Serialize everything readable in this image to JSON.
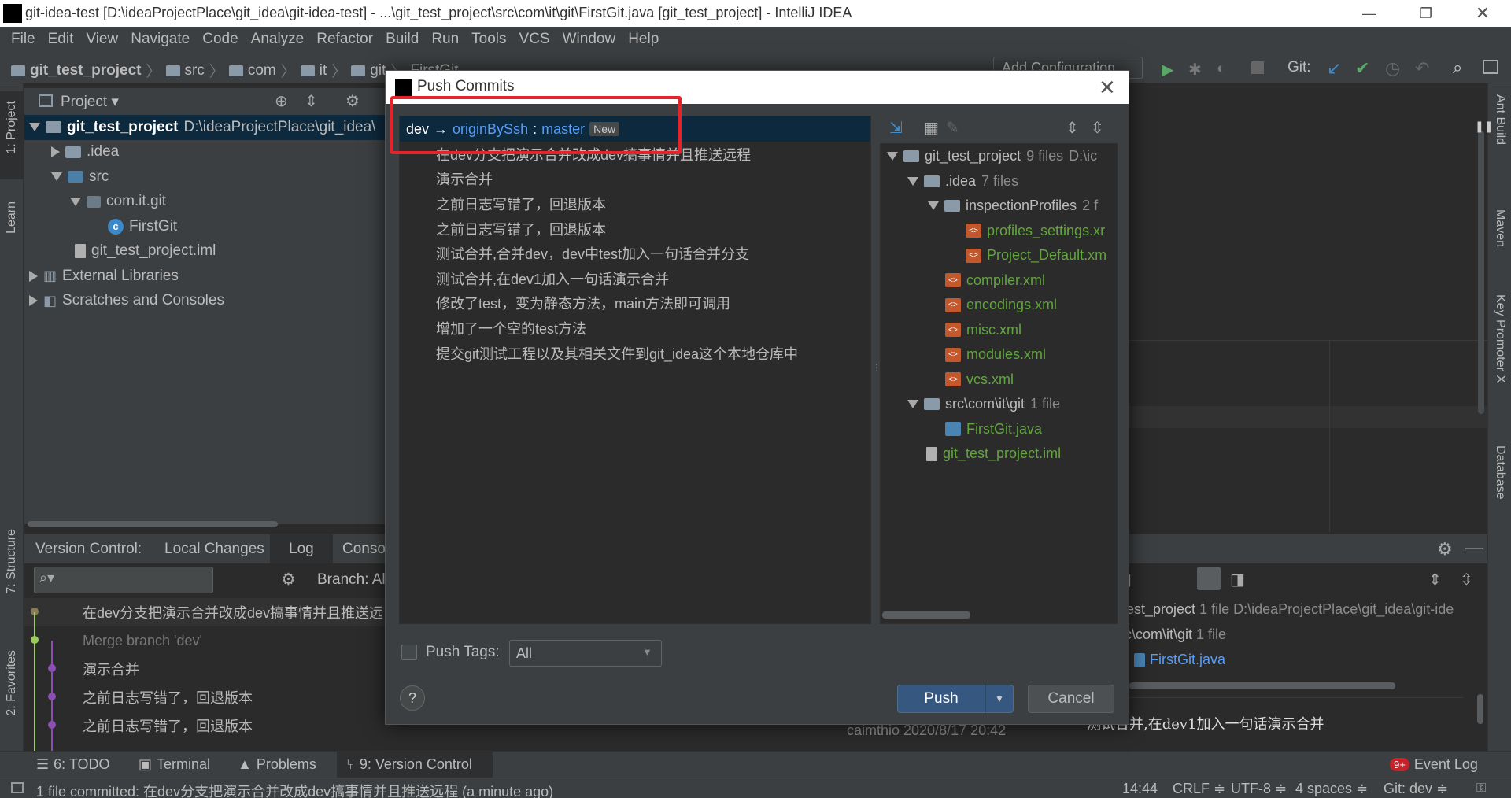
{
  "window": {
    "title": "git-idea-test [D:\\ideaProjectPlace\\git_idea\\git-idea-test] - ...\\git_test_project\\src\\com\\it\\git\\FirstGit.java [git_test_project] - IntelliJ IDEA"
  },
  "menu": [
    "File",
    "Edit",
    "View",
    "Navigate",
    "Code",
    "Analyze",
    "Refactor",
    "Build",
    "Run",
    "Tools",
    "VCS",
    "Window",
    "Help"
  ],
  "breadcrumb": [
    "git_test_project",
    "src",
    "com",
    "it",
    "git",
    "FirstGit"
  ],
  "navbar": {
    "run_config": "Add Configuration...",
    "git_label": "Git:"
  },
  "left_strip": {
    "project": "1: Project",
    "learn": "Learn",
    "structure": "7: Structure",
    "favorites": "2: Favorites"
  },
  "right_strip": {
    "ant": "Ant Build",
    "maven": "Maven",
    "key_promoter": "Key Promoter X",
    "database": "Database"
  },
  "project_panel": {
    "title": "Project",
    "root_name": "git_test_project",
    "root_path": "D:\\ideaProjectPlace\\git_idea\\",
    "items": [
      ".idea",
      "src",
      "com.it.git",
      "FirstGit",
      "git_test_project.iml",
      "External Libraries",
      "Scratches and Consoles"
    ]
  },
  "vc_panel": {
    "label": "Version Control:",
    "tabs": [
      "Local Changes",
      "Log",
      "Conso"
    ],
    "branch": "Branch: Al",
    "search_placeholder": "",
    "log": [
      "在dev分支把演示合并改成dev搞事情并且推送远",
      "Merge branch 'dev'",
      "演示合并",
      "之前日志写错了，回退版本",
      "之前日志写错了，回退版本"
    ],
    "right_tree": {
      "root": "est_project",
      "root_count": "1 file",
      "root_path": "D:\\ideaProjectPlace\\git_idea\\git-ide",
      "pkg": "c\\com\\it\\git",
      "pkg_count": "1 file",
      "file": "FirstGit.java"
    },
    "detail_text": "测试合并,在dev1加入一句话演示合并",
    "author_line": "caimthio   2020/8/17 20:42"
  },
  "dialog": {
    "title": "Push Commits",
    "push_target": {
      "source": "dev",
      "arrow": "→",
      "remote": "originBySsh",
      "sep": ":",
      "branch": "master",
      "badge": "New"
    },
    "commits": [
      "在dev分支把演示合并改成dev搞事情并且推送远程",
      "演示合并",
      "之前日志写错了，回退版本",
      "之前日志写错了，回退版本",
      "测试合并,合并dev，dev中test加入一句话合并分支",
      "测试合并,在dev1加入一句话演示合并",
      "修改了test，变为静态方法，main方法即可调用",
      "增加了一个空的test方法",
      "提交git测试工程以及其相关文件到git_idea这个本地仓库中"
    ],
    "files": {
      "root": "git_test_project",
      "root_count": "9 files",
      "root_path": "D:\\ic",
      "idea": ".idea",
      "idea_count": "7 files",
      "inspection": "inspectionProfiles",
      "inspection_count": "2 f",
      "profiles": "profiles_settings.xr",
      "project_default": "Project_Default.xm",
      "compiler": "compiler.xml",
      "encodings": "encodings.xml",
      "misc": "misc.xml",
      "modules": "modules.xml",
      "vcs": "vcs.xml",
      "src": "src\\com\\it\\git",
      "src_count": "1 file",
      "firstgit": "FirstGit.java",
      "iml": "git_test_project.iml"
    },
    "push_tags_label": "Push Tags:",
    "push_tags_value": "All",
    "push_label": "Push",
    "cancel_label": "Cancel",
    "help": "?"
  },
  "bottom_tools": {
    "todo": "6: TODO",
    "terminal": "Terminal",
    "problems": "Problems",
    "vc": "9: Version Control",
    "event_badge": "9+",
    "event": "Event Log"
  },
  "status": {
    "message": "1 file committed: 在dev分支把演示合并改成dev搞事情并且推送远程 (a minute ago)",
    "pos": "14:44",
    "crlf": "CRLF ≑",
    "encoding": "UTF-8 ≑",
    "indent": "4 spaces ≑",
    "git": "Git: dev ≑"
  },
  "colors": {
    "accent": "#589df6",
    "highlight": "#e8222b",
    "bg": "#3c3f41"
  }
}
